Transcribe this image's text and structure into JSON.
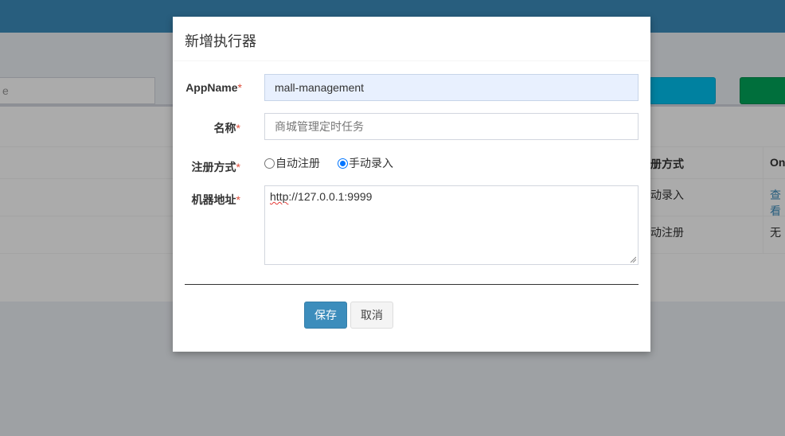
{
  "background": {
    "search_placeholder_fragment": "e",
    "table_headers": {
      "register_type": "册方式",
      "online": "On"
    },
    "rows": [
      {
        "register_type": "动录入",
        "online": "查看"
      },
      {
        "register_type": "动注册",
        "online": "无"
      }
    ],
    "footer_fragment": ")"
  },
  "modal": {
    "title": "新增执行器",
    "fields": {
      "appname": {
        "label": "AppName",
        "required_mark": "*",
        "value": "mall-management"
      },
      "name": {
        "label": "名称",
        "required_mark": "*",
        "placeholder": "商城管理定时任务"
      },
      "register_type": {
        "label": "注册方式",
        "required_mark": "*",
        "options": [
          {
            "label": "自动注册",
            "checked": false
          },
          {
            "label": "手动录入",
            "checked": true
          }
        ]
      },
      "address": {
        "label": "机器地址",
        "required_mark": "*",
        "value_prefix": "http",
        "value_rest": "://127.0.0.1:9999"
      }
    },
    "buttons": {
      "save": "保存",
      "cancel": "取消"
    }
  },
  "colors": {
    "topbar": "#3c8dbc",
    "save_button": "#3c8dbc",
    "required": "#dd4b39",
    "info_button": "#00c0ef",
    "success_button": "#00a65a"
  }
}
